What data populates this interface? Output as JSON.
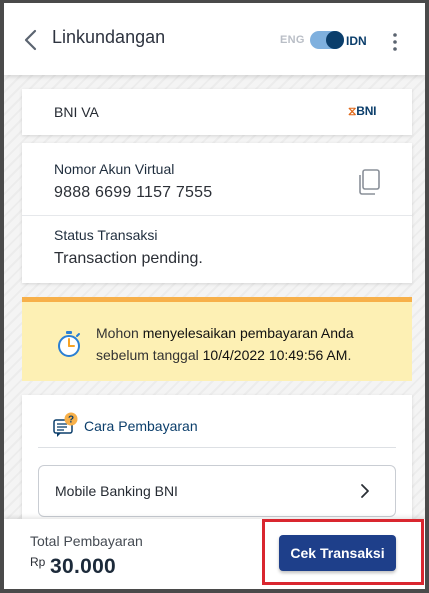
{
  "header": {
    "title": "Linkundangan",
    "lang_eng": "ENG",
    "lang_idn": "IDN",
    "lang_selected": "IDN"
  },
  "bank": {
    "name": "BNI VA",
    "logo_text": "BNI"
  },
  "virtual_account": {
    "label": "Nomor Akun Virtual",
    "number": "9888 6699 1157 7555"
  },
  "status": {
    "label": "Status Transaksi",
    "value": "Transaction pending."
  },
  "notice": {
    "part1": "Mohon ",
    "part2": "menyelesaikan pembayaran Anda",
    "part3": "sebelum tanggal ",
    "deadline": "10/4/2022 10:49:56 AM",
    "part4": "."
  },
  "payment": {
    "title": "Cara Pembayaran",
    "method": "Mobile Banking BNI"
  },
  "footer": {
    "total_label": "Total Pembayaran",
    "currency": "Rp",
    "total_value": "30.000",
    "button_label": "Cek Transaksi"
  },
  "colors": {
    "primary": "#1e3f8a",
    "accent_orange": "#f7b04a",
    "notice_bg": "#fdf0b4",
    "highlight_red": "#d9262f"
  }
}
